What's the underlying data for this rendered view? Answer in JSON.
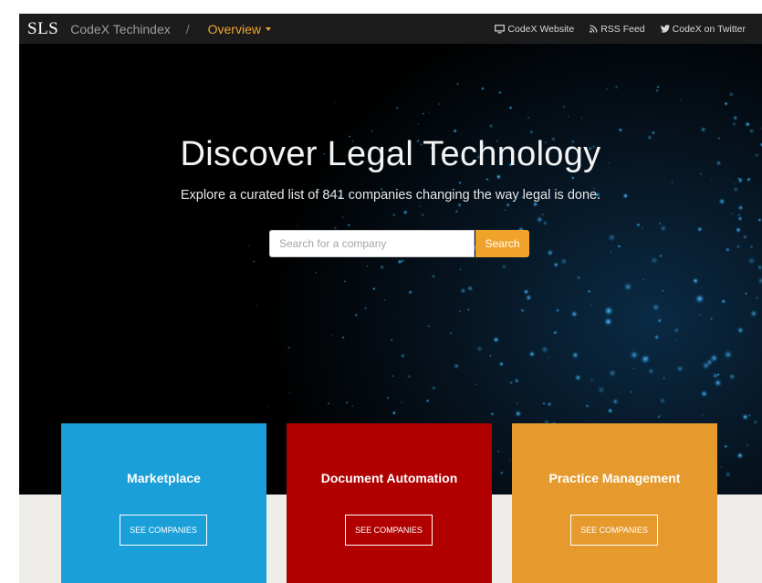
{
  "navbar": {
    "brand": "SLS",
    "site_name": "CodeX Techindex",
    "separator": "/",
    "section": "Overview",
    "links": [
      {
        "label": "CodeX Website",
        "icon": "monitor-icon"
      },
      {
        "label": "RSS Feed",
        "icon": "rss-icon"
      },
      {
        "label": "CodeX on Twitter",
        "icon": "twitter-icon"
      }
    ]
  },
  "hero": {
    "headline": "Discover Legal Technology",
    "subline": "Explore a curated list of 841 companies changing the way legal is done.",
    "search": {
      "placeholder": "Search for a company",
      "value": "",
      "button_label": "Search"
    }
  },
  "categories": [
    {
      "title": "Marketplace",
      "button_label": "SEE COMPANIES",
      "color": "#1a9fd8"
    },
    {
      "title": "Document Automation",
      "button_label": "SEE COMPANIES",
      "color": "#b10000"
    },
    {
      "title": "Practice Management",
      "button_label": "SEE COMPANIES",
      "color": "#e69a2e"
    }
  ],
  "colors": {
    "accent": "#f0a32b",
    "navbar_bg": "#1c1c1c",
    "strip_bg": "#efedea"
  }
}
